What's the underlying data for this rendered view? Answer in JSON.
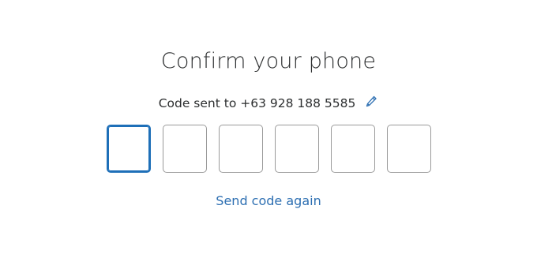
{
  "title": "Confirm your phone",
  "sent": {
    "prefix": "Code sent to",
    "phone": "+63 928 188 5585",
    "edit_icon": "pencil-icon"
  },
  "code_inputs": [
    {
      "value": "",
      "active": true
    },
    {
      "value": "",
      "active": false
    },
    {
      "value": "",
      "active": false
    },
    {
      "value": "",
      "active": false
    },
    {
      "value": "",
      "active": false
    },
    {
      "value": "",
      "active": false
    }
  ],
  "resend_label": "Send code again",
  "colors": {
    "accent": "#1e6fb8",
    "link": "#2d6fb2",
    "text": "#2c2e2f",
    "input_border": "#9a9a9a"
  }
}
